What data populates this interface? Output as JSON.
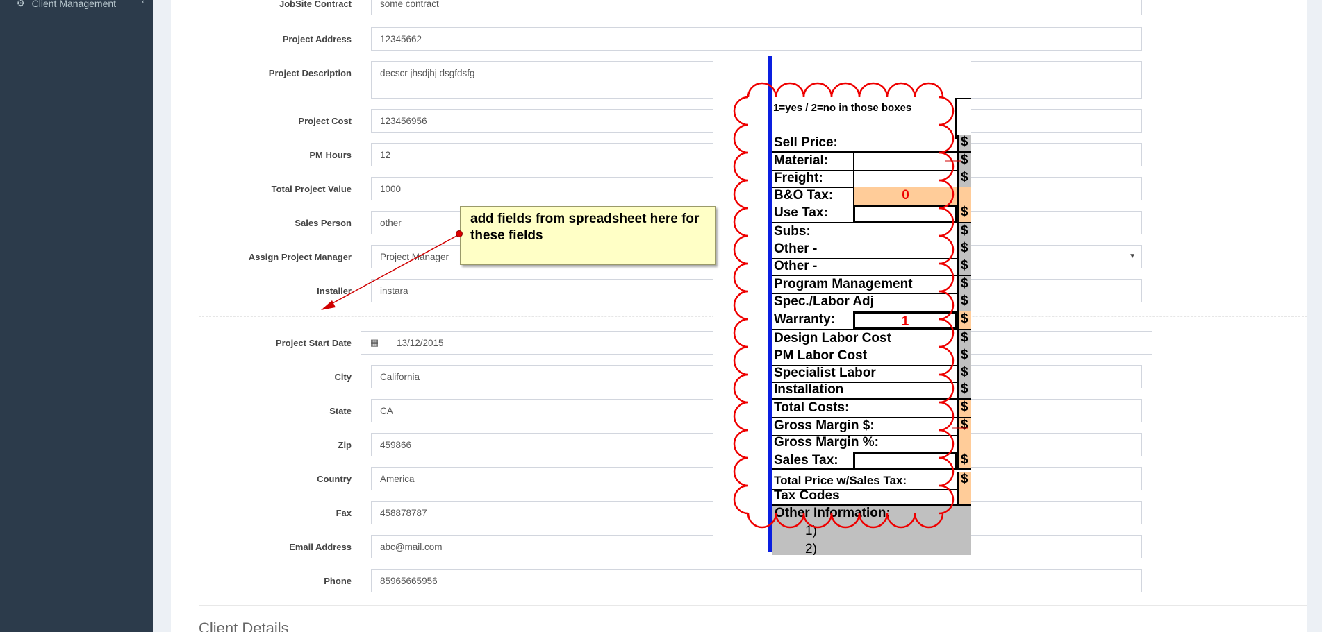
{
  "sidebar": {
    "items": [
      {
        "label": "Client Management",
        "icon": "users-icon"
      }
    ]
  },
  "form": {
    "jobsite_contract": {
      "label": "JobSite Contract",
      "value": "some contract"
    },
    "project_address": {
      "label": "Project Address",
      "value": "12345662"
    },
    "project_description": {
      "label": "Project Description",
      "value": "decscr jhsdjhj dsgfdsfg"
    },
    "project_cost": {
      "label": "Project Cost",
      "value": "123456956"
    },
    "pm_hours": {
      "label": "PM Hours",
      "value": "12"
    },
    "total_project_value": {
      "label": "Total Project Value",
      "value": "1000"
    },
    "sales_person": {
      "label": "Sales Person",
      "value": "other"
    },
    "assign_project_manager": {
      "label": "Assign Project Manager",
      "value": "Project Manager"
    },
    "installer": {
      "label": "Installer",
      "value": "instara"
    },
    "project_start_date": {
      "label": "Project Start Date",
      "value": "13/12/2015"
    },
    "city": {
      "label": "City",
      "value": "California"
    },
    "state": {
      "label": "State",
      "value": "CA"
    },
    "zip": {
      "label": "Zip",
      "value": "459866"
    },
    "country": {
      "label": "Country",
      "value": "America"
    },
    "fax": {
      "label": "Fax",
      "value": "458878787"
    },
    "email": {
      "label": "Email Address",
      "value": "abc@mail.com"
    },
    "phone": {
      "label": "Phone",
      "value": "85965665956"
    }
  },
  "section": {
    "client_details": "Client Details"
  },
  "annotation": {
    "note_text": "add fields from spreadsheet here for these fields",
    "colors": {
      "note_bg": "#ffffc6",
      "arrow": "#d00000",
      "cloud": "#ee0000"
    }
  },
  "spreadsheet": {
    "header_note": "1=yes / 2=no in those boxes",
    "rows": [
      {
        "label": "Sell Price:",
        "dollar": "$"
      },
      {
        "label": "Material:",
        "dollar": "$"
      },
      {
        "label": "Freight:",
        "dollar": "$"
      },
      {
        "label": "B&O Tax:",
        "value": "0",
        "dollar": ""
      },
      {
        "label": "Use Tax:",
        "dollar": "$"
      },
      {
        "label": "Subs:",
        "dollar": "$"
      },
      {
        "label": "Other -",
        "dollar": "$"
      },
      {
        "label": "Other -",
        "dollar": "$"
      },
      {
        "label": "Program Management",
        "dollar": "$"
      },
      {
        "label": "Spec./Labor Adj",
        "dollar": "$"
      },
      {
        "label": "Warranty:",
        "value": "1",
        "dollar": "$"
      },
      {
        "label": "Design Labor Cost",
        "dollar": "$"
      },
      {
        "label": "PM Labor Cost",
        "dollar": "$"
      },
      {
        "label": "Specialist Labor",
        "dollar": "$"
      },
      {
        "label": "Installation",
        "dollar": "$"
      },
      {
        "label": "Total Costs:",
        "dollar": "$"
      },
      {
        "label": "Gross Margin $:",
        "dollar": "$"
      },
      {
        "label": "Gross Margin %:",
        "dollar": ""
      },
      {
        "label": "Sales Tax:",
        "dollar": "$"
      },
      {
        "label": "Total Price w/Sales Tax:",
        "dollar": "$"
      },
      {
        "label": "Tax Codes",
        "dollar": ""
      }
    ],
    "other_information": "Other Information:",
    "other_lines": [
      "1)",
      "2)"
    ]
  }
}
